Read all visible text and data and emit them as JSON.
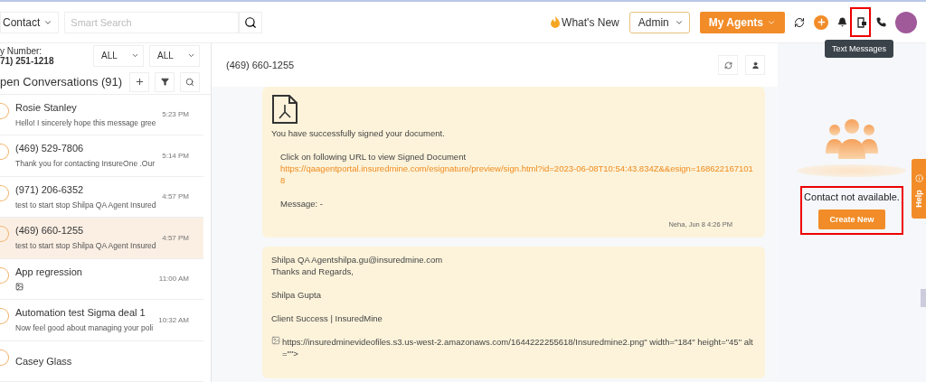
{
  "topbar": {
    "search_scope": "Contact",
    "search": {
      "placeholder": "Smart Search"
    },
    "whats_new": "What's New",
    "role": "Admin",
    "agents_button": "My Agents",
    "tooltip": "Text Messages",
    "text_messages_highlighted": true
  },
  "sidebar": {
    "number_label": "y Number:",
    "number": "71) 251-1218",
    "filters": [
      "ALL",
      "ALL"
    ],
    "title": "pen Conversations (91)",
    "conversations": [
      {
        "name": "Rosie Stanley",
        "preview": "Hello! I sincerely hope this message gree",
        "time": "5:23 PM",
        "selected": false,
        "attachment": false
      },
      {
        "name": "(469) 529-7806",
        "preview": "Thank you for contacting InsureOne .Our",
        "time": "5:14 PM",
        "selected": false,
        "attachment": false
      },
      {
        "name": "(971) 206-6352",
        "preview": "test to start stop Shilpa QA Agent Insured",
        "time": "4:57 PM",
        "selected": false,
        "attachment": false
      },
      {
        "name": "(469) 660-1255",
        "preview": "test to start stop Shilpa QA Agent Insured",
        "time": "4:57 PM",
        "selected": true,
        "attachment": false
      },
      {
        "name": "App regression",
        "time": "11:00 AM",
        "selected": false,
        "attachment": true
      },
      {
        "name": "Automation test Sigma deal 1",
        "preview": "Now feel good about managing your poli",
        "time": "10:32 AM",
        "selected": false,
        "attachment": false
      },
      {
        "name": "Casey Glass",
        "selected": false,
        "attachment": false
      }
    ]
  },
  "chat": {
    "title": "(469) 660-1255",
    "messages": [
      {
        "kind": "document",
        "lines": [
          "You have successfully signed your document."
        ],
        "indented": [
          "Click on following URL to view Signed Document"
        ],
        "link": "https://qaagentportal.insuredmine.com/esignature/preview/sign.html?id=2023-06-08T10:54:43.834Z&&esign=1686221671018",
        "note": "Message: -",
        "footer": "Neha,  Jun 8 4:26 PM"
      },
      {
        "kind": "text",
        "paragraphs": [
          [
            "Shilpa QA Agentshilpa.gu@insuredmine.com",
            "Thanks and Regards,"
          ],
          [
            "Shilpa Gupta"
          ],
          [
            "Client Success | InsuredMine"
          ]
        ],
        "image_alt": "https://insuredminevideofiles.s3.us-west-2.amazonaws.com/1644222255618/Insuredmine2.png\" width=\"184\" height=\"45\" alt=\"\">"
      }
    ]
  },
  "contact_panel": {
    "message": "Contact not available.",
    "button": "Create New",
    "highlighted": true,
    "help_tab": "Help"
  }
}
